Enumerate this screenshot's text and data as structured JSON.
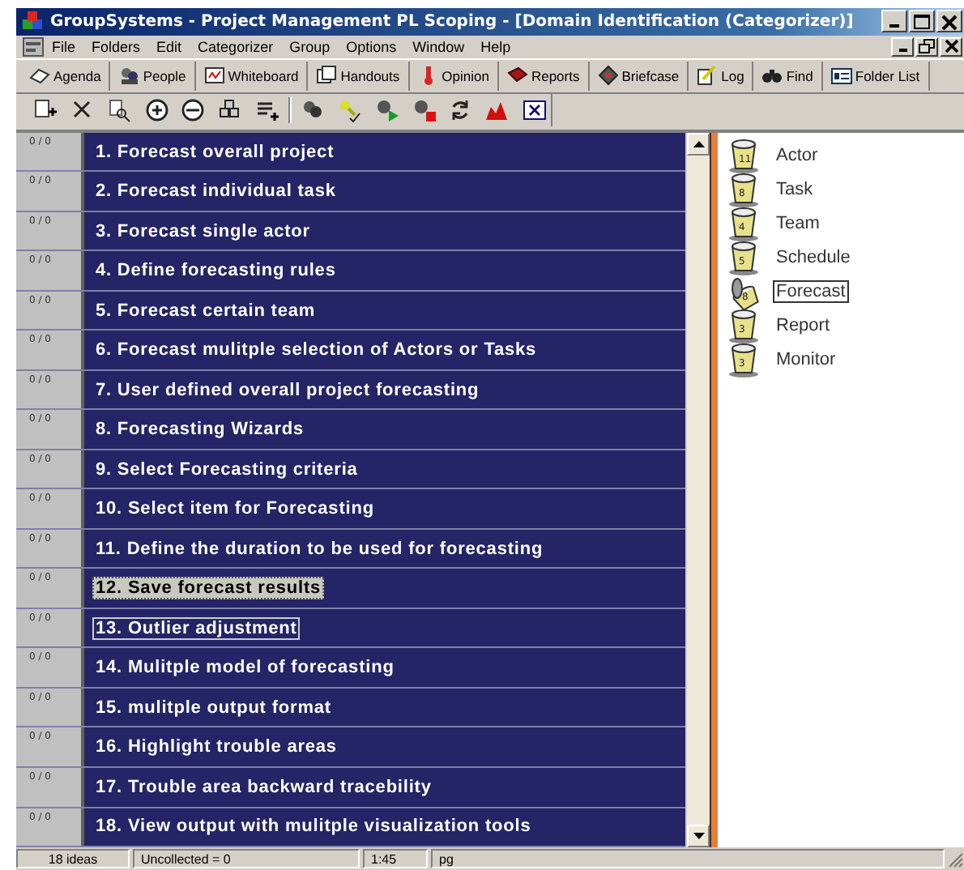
{
  "window": {
    "title": "GroupSystems - Project Management PL Scoping - [Domain Identification (Categorizer)]"
  },
  "menu": [
    "File",
    "Folders",
    "Edit",
    "Categorizer",
    "Group",
    "Options",
    "Window",
    "Help"
  ],
  "toolbar": [
    "Agenda",
    "People",
    "Whiteboard",
    "Handouts",
    "Opinion",
    "Reports",
    "Briefcase",
    "Log",
    "Find",
    "Folder List"
  ],
  "ideas": [
    {
      "count": "0 / 0",
      "text": "1. Forecast overall project",
      "selected": false,
      "focused": false
    },
    {
      "count": "0 / 0",
      "text": "2. Forecast individual task",
      "selected": false,
      "focused": false
    },
    {
      "count": "0 / 0",
      "text": "3. Forecast single actor",
      "selected": false,
      "focused": false
    },
    {
      "count": "0 / 0",
      "text": "4. Define forecasting rules",
      "selected": false,
      "focused": false
    },
    {
      "count": "0 / 0",
      "text": "5. Forecast certain team",
      "selected": false,
      "focused": false
    },
    {
      "count": "0 / 0",
      "text": "6. Forecast mulitple selection of Actors or Tasks",
      "selected": false,
      "focused": false
    },
    {
      "count": "0 / 0",
      "text": "7. User defined overall project forecasting",
      "selected": false,
      "focused": false
    },
    {
      "count": "0 / 0",
      "text": "8. Forecasting Wizards",
      "selected": false,
      "focused": false
    },
    {
      "count": "0 / 0",
      "text": "9. Select Forecasting criteria",
      "selected": false,
      "focused": false
    },
    {
      "count": "0 / 0",
      "text": "10. Select item for Forecasting",
      "selected": false,
      "focused": false
    },
    {
      "count": "0 / 0",
      "text": "11. Define the duration to be used for forecasting",
      "selected": false,
      "focused": false
    },
    {
      "count": "0 / 0",
      "text": "12. Save forecast results",
      "selected": true,
      "focused": false
    },
    {
      "count": "0 / 0",
      "text": "13. Outlier adjustment",
      "selected": false,
      "focused": true
    },
    {
      "count": "0 / 0",
      "text": "14. Mulitple model of forecasting",
      "selected": false,
      "focused": false
    },
    {
      "count": "0 / 0",
      "text": "15. mulitple output format",
      "selected": false,
      "focused": false
    },
    {
      "count": "0 / 0",
      "text": "16. Highlight trouble areas",
      "selected": false,
      "focused": false
    },
    {
      "count": "0 / 0",
      "text": "17. Trouble area backward tracebility",
      "selected": false,
      "focused": false
    },
    {
      "count": "0 / 0",
      "text": "18. View output with mulitple visualization tools",
      "selected": false,
      "focused": false
    }
  ],
  "categories": [
    {
      "label": "Actor",
      "count": "11",
      "selected": false,
      "tipped": false
    },
    {
      "label": "Task",
      "count": "8",
      "selected": false,
      "tipped": false
    },
    {
      "label": "Team",
      "count": "4",
      "selected": false,
      "tipped": false
    },
    {
      "label": "Schedule",
      "count": "5",
      "selected": false,
      "tipped": false
    },
    {
      "label": "Forecast",
      "count": "8",
      "selected": true,
      "tipped": true
    },
    {
      "label": "Report",
      "count": "3",
      "selected": false,
      "tipped": false
    },
    {
      "label": "Monitor",
      "count": "3",
      "selected": false,
      "tipped": false
    }
  ],
  "status_bar": [
    "18 ideas",
    "Uncollected = 0",
    "1:45",
    "pg"
  ]
}
